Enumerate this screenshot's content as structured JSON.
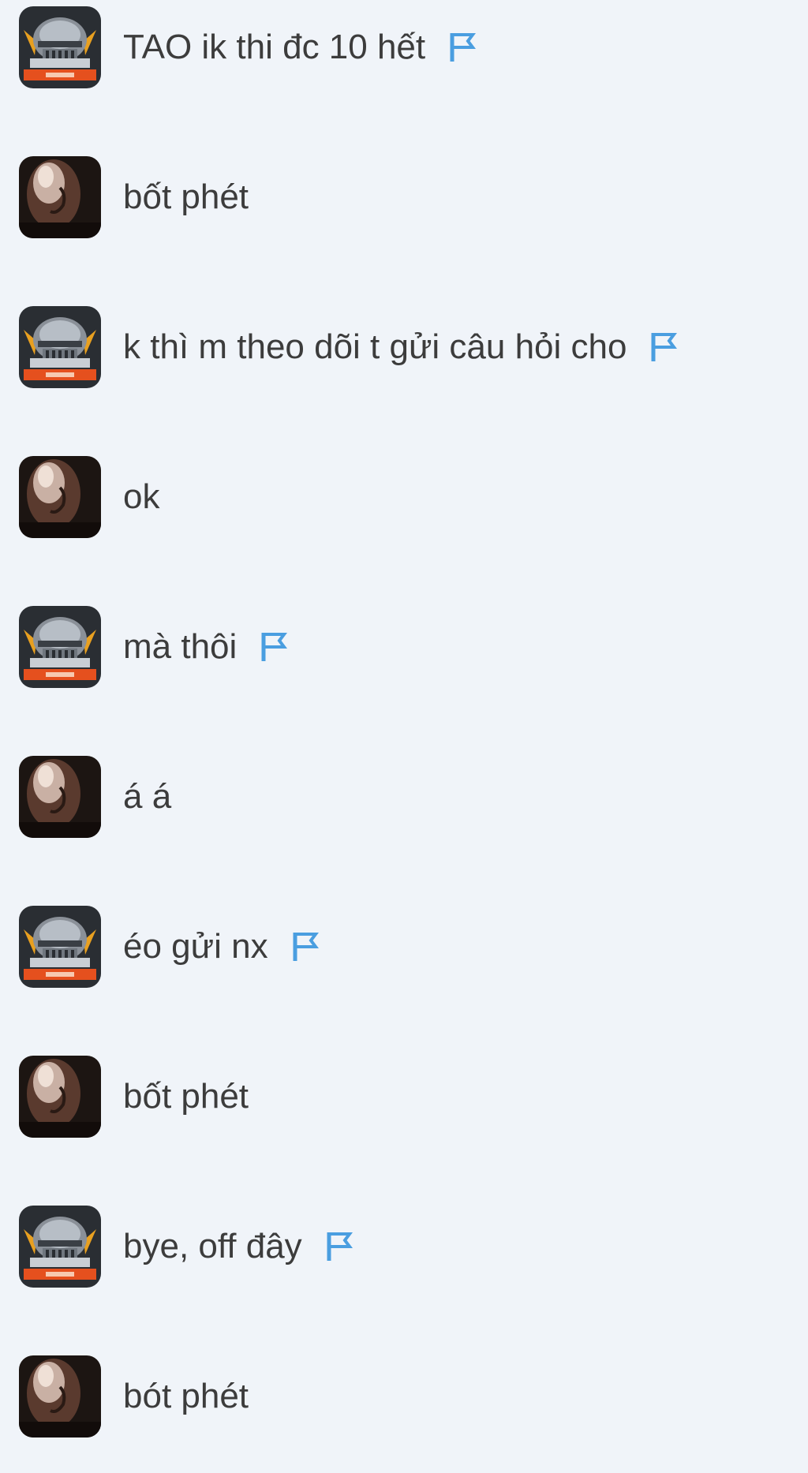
{
  "messages": [
    {
      "sender": "robot",
      "text": "TAO ik thi đc 10 hết",
      "flag": true
    },
    {
      "sender": "bald",
      "text": "bốt phét",
      "flag": false
    },
    {
      "sender": "robot",
      "text": "k thì m theo dõi t gửi câu hỏi cho",
      "flag": true
    },
    {
      "sender": "bald",
      "text": "ok",
      "flag": false
    },
    {
      "sender": "robot",
      "text": "mà thôi",
      "flag": true
    },
    {
      "sender": "bald",
      "text": "á á",
      "flag": false
    },
    {
      "sender": "robot",
      "text": "éo gửi nx",
      "flag": true
    },
    {
      "sender": "bald",
      "text": "bốt phét",
      "flag": false
    },
    {
      "sender": "robot",
      "text": "bye, off đây",
      "flag": true
    },
    {
      "sender": "bald",
      "text": "bót phét",
      "flag": false
    }
  ],
  "icons": {
    "robot_avatar": "robot-helmet-avatar-icon",
    "bald_avatar": "bald-man-avatar-icon",
    "flag": "report-flag-icon"
  },
  "colors": {
    "background": "#f0f4f9",
    "text": "#3c3c3c",
    "flag": "#4a9ee0"
  }
}
